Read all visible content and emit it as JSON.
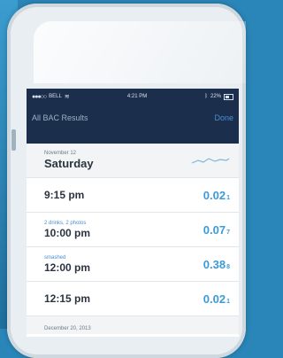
{
  "statusbar": {
    "carrier": "BELL",
    "time": "4:21 PM",
    "battery": "22%"
  },
  "nav": {
    "title": "All BAC Results",
    "done_label": "Done"
  },
  "day1": {
    "date": "November 12",
    "weekday": "Saturday"
  },
  "entries": [
    {
      "note": "",
      "time": "9:15 pm",
      "value": "0.02",
      "suffix": "1"
    },
    {
      "note": "2 drinks, 2 photos",
      "time": "10:00 pm",
      "value": "0.07",
      "suffix": "7"
    },
    {
      "note": "smashed",
      "time": "12:00 pm",
      "value": "0.38",
      "suffix": "8"
    },
    {
      "note": "",
      "time": "12:15 pm",
      "value": "0.02",
      "suffix": "1"
    }
  ],
  "day2": {
    "date": "December 20, 2013"
  },
  "colors": {
    "nav_bg": "#1b2e4b",
    "accent": "#3b9bd9",
    "done": "#4a8fd6",
    "page_bg": "#2a86b8"
  }
}
